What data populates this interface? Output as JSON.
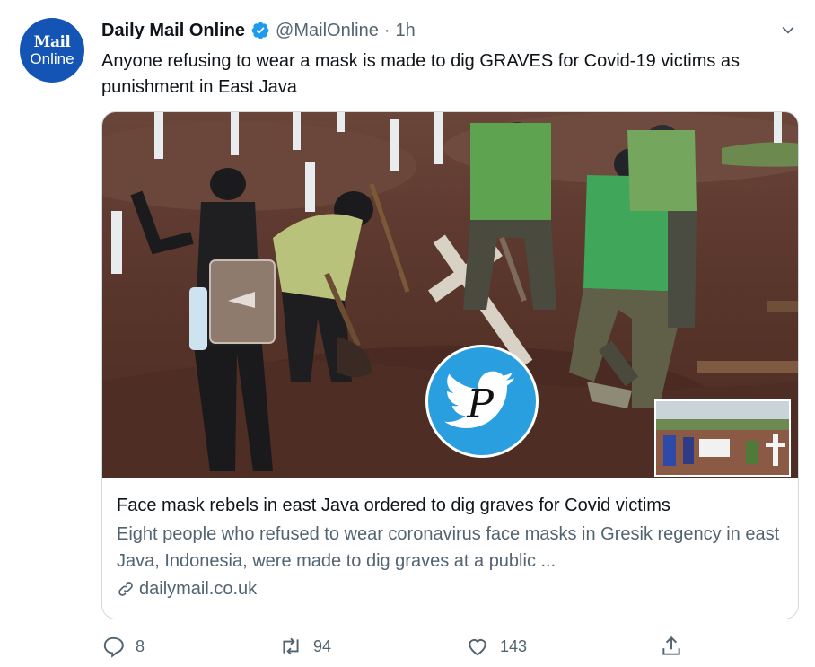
{
  "account": {
    "avatar_line1": "Mail",
    "avatar_line2": "Online",
    "name": "Daily Mail Online",
    "handle": "@MailOnline",
    "separator": "·",
    "time": "1h"
  },
  "tweet": {
    "text": "Anyone refusing to wear a mask is made to dig GRAVES for Covid-19 victims as punishment in East Java"
  },
  "card": {
    "title": "Face mask rebels in east Java ordered to dig graves for Covid victims",
    "description": "Eight people who refused to wear coronavirus face masks in Gresik regency in east Java, Indonesia, were made to dig graves at a public ...",
    "domain": "dailymail.co.uk",
    "watermark_letter": "P"
  },
  "actions": {
    "replies": "8",
    "retweets": "94",
    "likes": "143"
  },
  "colors": {
    "brand_blue": "#1354b5",
    "verified_blue": "#1d9bf0",
    "muted_text": "#536471",
    "watermark_blue": "#2a9fe0"
  },
  "icons": [
    "verified-badge-icon",
    "chevron-down-icon",
    "link-icon",
    "reply-icon",
    "retweet-icon",
    "like-icon",
    "share-icon"
  ]
}
